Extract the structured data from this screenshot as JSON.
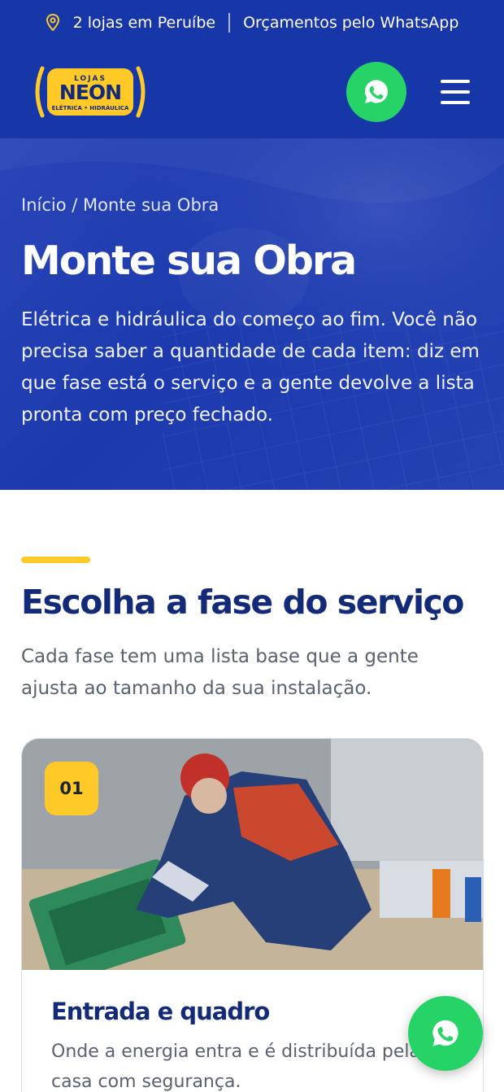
{
  "topbar": {
    "stores": "2 lojas em Peruíbe",
    "whatsapp_quotes": "Orçamentos pelo WhatsApp"
  },
  "header": {
    "logo_text": "LOJAS NEON ELÉTRICA • HIDRÁULICA",
    "whatsapp_icon": "whatsapp-icon",
    "menu_icon": "hamburger-menu-icon"
  },
  "hero": {
    "breadcrumb_home": "Início",
    "breadcrumb_sep": " / ",
    "breadcrumb_current": "Monte sua Obra",
    "title": "Monte sua Obra",
    "description": "Elétrica e hidráulica do começo ao fim. Você não precisa saber a quantidade de cada item: diz em que fase está o serviço e a gente devolve a lista pronta com preço fechado."
  },
  "section": {
    "title": "Escolha a fase do serviço",
    "subtitle": "Cada fase tem uma lista base que a gente ajusta ao tamanho da sua instalação."
  },
  "card": {
    "badge": "01",
    "title": "Entrada e quadro",
    "description": "Onde a energia entra e é distribuída pela casa com segurança."
  },
  "colors": {
    "brand_blue": "#1736a8",
    "accent_yellow": "#ffc928",
    "whatsapp_green": "#25d366",
    "heading_navy": "#132a78"
  }
}
